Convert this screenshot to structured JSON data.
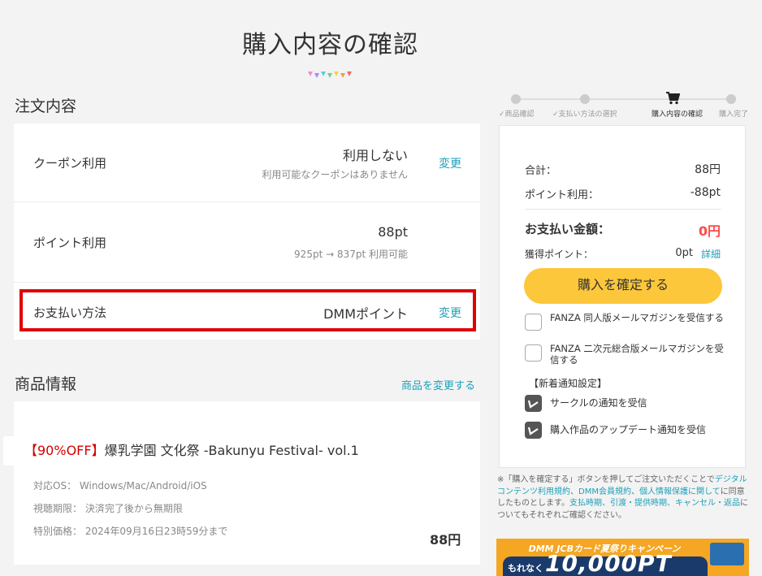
{
  "page_title": "購入内容の確認",
  "order_section": {
    "title": "注文内容",
    "coupon": {
      "label": "クーポン利用",
      "value": "利用しない",
      "sub": "利用可能なクーポンはありません",
      "link": "変更"
    },
    "points": {
      "label": "ポイント利用",
      "value": "88pt",
      "sub": "925pt → 837pt 利用可能"
    },
    "payment": {
      "label": "お支払い方法",
      "value": "DMMポイント",
      "link": "変更"
    }
  },
  "product_section": {
    "title": "商品情報",
    "change_link": "商品を変更する",
    "discount_tag": "【90%OFF】",
    "product_name": "爆乳学園 文化祭 -Bakunyu Festival- vol.1",
    "os": "対応OS： Windows/Mac/Android/iOS",
    "period": "視聴期限： 決済完了後から無期限",
    "special_price": "特別価格： 2024年09月16日23時59分まで",
    "price": "88円"
  },
  "steps": [
    {
      "label": "✓商品確認",
      "state": "done"
    },
    {
      "label": "✓支払い方法の選択",
      "state": "done"
    },
    {
      "label": "購入内容の確認",
      "state": "active"
    },
    {
      "label": "購入完了",
      "state": "todo"
    }
  ],
  "summary": {
    "total_label": "合計：",
    "total_value": "88円",
    "points_label": "ポイント利用：",
    "points_value": "-88pt",
    "pay_label": "お支払い金額：",
    "pay_value": "0円",
    "earn_label": "獲得ポイント：",
    "earn_value": "0pt",
    "earn_link": "詳細",
    "confirm_button": "購入を確定する",
    "newsletter1": "FANZA 同人版メールマガジンを受信する",
    "newsletter2": "FANZA 二次元総合版メールマガジンを受信する",
    "notify_heading": "【新着通知設定】",
    "notify1": "サークルの通知を受信",
    "notify2": "購入作品のアップデート通知を受信"
  },
  "note": {
    "prefix": "※「購入を確定する」ボタンを押してご注文いただくことで",
    "link1": "デジタルコンテンツ利用規約",
    "sep1": "、",
    "link2": "DMM会員規約",
    "sep2": "、",
    "link3": "個人情報保護に関して",
    "mid": "に同意したものとします。",
    "link4": "支払時期、引渡・提供時期、キャンセル・返品",
    "suffix": "についてもそれぞれご確認ください。"
  },
  "banner": {
    "top": "DMM JCBカード夏祭りキャンペーン",
    "small": "もれなく",
    "big": "10,000PT"
  },
  "colors": {
    "accent": "#1ea0b8",
    "button": "#fdc73c",
    "highlight": "#e00000",
    "discount": "#d40000",
    "pay_amount": "#ff4a4a"
  }
}
